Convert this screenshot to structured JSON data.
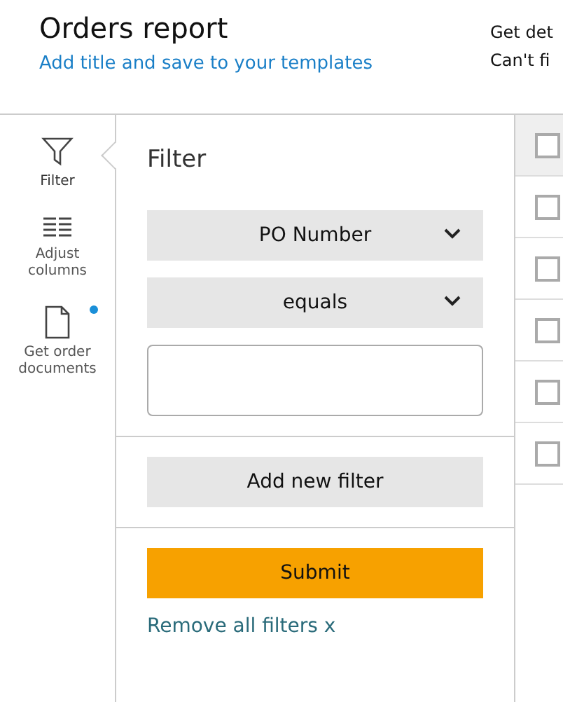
{
  "header": {
    "title": "Orders report",
    "link": "Add title and save to your templates",
    "side_lines": [
      "Get det",
      "Can't fi"
    ]
  },
  "sidebar": {
    "items": [
      {
        "kind": "filter",
        "label": "Filter",
        "selected": true,
        "notification": false
      },
      {
        "kind": "columns",
        "label": "Adjust columns",
        "selected": false,
        "notification": false
      },
      {
        "kind": "document",
        "label": "Get order documents",
        "selected": false,
        "notification": true
      }
    ]
  },
  "filter_panel": {
    "title": "Filter",
    "field_select": "PO Number",
    "operator_select": "equals",
    "add_button": "Add new filter",
    "submit_button": "Submit",
    "remove_link": "Remove all filters x"
  },
  "table": {
    "rows": [
      {
        "checked": false
      },
      {
        "checked": false
      },
      {
        "checked": false
      },
      {
        "checked": false
      },
      {
        "checked": false
      },
      {
        "checked": false
      }
    ]
  }
}
